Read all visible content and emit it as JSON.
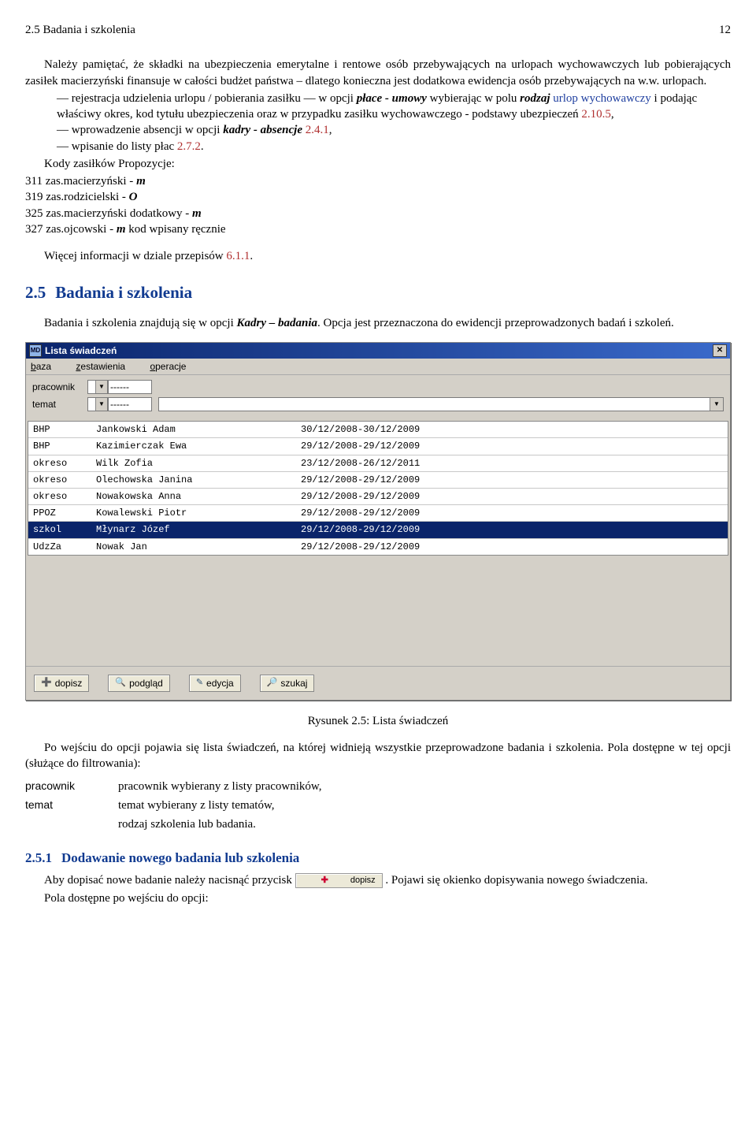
{
  "header": {
    "left": "2.5 Badania i szkolenia",
    "page": "12"
  },
  "intro1": "Należy pamiętać, że składki na ubezpieczenia emerytalne i rentowe osób przebywających na urlopach wychowawczych lub pobierających zasiłek macierzyński finansuje w całości budżet państwa – dlatego konieczna jest dodatkowa ewidencja osób przebywających na w.w. urlopach.",
  "bullets": [
    {
      "pre": "rejestracja udzielenia urlopu / pobierania zasiłku — w opcji ",
      "b1": "płace - umowy",
      "mid1": " wybierając w polu ",
      "b2": "rodzaj",
      "mid2": " ",
      "blue1": "urlop wychowawczy",
      "mid3": " i podając właściwy okres, kod tytułu ubezpieczenia oraz w przypadku zasiłku wychowawczego - podstawy ubezpieczeń ",
      "link1": "2.10.5",
      "tail": ","
    },
    {
      "pre": "wprowadzenie absencji w opcji ",
      "b1": "kadry - absencje",
      "mid1": " ",
      "link1": "2.4.1",
      "tail": ","
    },
    {
      "pre": "wpisanie do listy płac ",
      "link1": "2.7.2",
      "tail": "."
    }
  ],
  "kody_header": "Kody zasiłków Propozycje:",
  "kody": [
    {
      "t": "311 zas.macierzyński - ",
      "b": "m"
    },
    {
      "t": "319 zas.rodzicielski - ",
      "b": "O"
    },
    {
      "t": "325 zas.macierzyński dodatkowy - ",
      "b": "m"
    },
    {
      "t": "327 zas.ojcowski - ",
      "b": "m",
      "extra": " kod wpisany ręcznie"
    }
  ],
  "more_info_pre": "Więcej informacji w dziale przepisów ",
  "more_info_link": "6.1.1",
  "more_info_tail": ".",
  "sec25_num": "2.5",
  "sec25_title": "Badania i szkolenia",
  "sec25_intro_pre": "Badania i szkolenia znajdują się w opcji ",
  "sec25_intro_b": "Kadry – badania",
  "sec25_intro_tail": ". Opcja jest przeznaczona do ewidencji przeprowadzonych badań i szkoleń.",
  "window": {
    "title": "Lista świadczeń",
    "icon_text": "MD",
    "menu": [
      {
        "u": "b",
        "rest": "aza"
      },
      {
        "u": "z",
        "rest": "estawienia"
      },
      {
        "u": "o",
        "rest": "peracje"
      }
    ],
    "filter1_label": "pracownik",
    "filter1_value": "------",
    "filter2_label": "temat",
    "filter2_value": "------",
    "rows": [
      {
        "c1": "BHP",
        "c2": "Jankowski Adam",
        "c3": "30/12/2008-30/12/2009",
        "sel": false
      },
      {
        "c1": "BHP",
        "c2": "Kazimierczak Ewa",
        "c3": "29/12/2008-29/12/2009",
        "sel": false
      },
      {
        "c1": "okreso",
        "c2": "Wilk Zofia",
        "c3": "23/12/2008-26/12/2011",
        "sel": false
      },
      {
        "c1": "okreso",
        "c2": "Olechowska Janina",
        "c3": "29/12/2008-29/12/2009",
        "sel": false
      },
      {
        "c1": "okreso",
        "c2": "Nowakowska Anna",
        "c3": "29/12/2008-29/12/2009",
        "sel": false
      },
      {
        "c1": "PPOZ",
        "c2": "Kowalewski Piotr",
        "c3": "29/12/2008-29/12/2009",
        "sel": false
      },
      {
        "c1": "szkol",
        "c2": "Młynarz Józef",
        "c3": "29/12/2008-29/12/2009",
        "sel": true
      },
      {
        "c1": "UdzZa",
        "c2": "Nowak Jan",
        "c3": "29/12/2008-29/12/2009",
        "sel": false
      }
    ],
    "buttons": [
      {
        "icon": "➕",
        "color": "#c03",
        "label": "dopisz"
      },
      {
        "icon": "🔍",
        "color": "#357",
        "label": "podgląd"
      },
      {
        "icon": "✎",
        "color": "#357",
        "label": "edycja"
      },
      {
        "icon": "🔎",
        "color": "#775",
        "label": "szukaj"
      }
    ]
  },
  "fig_caption": "Rysunek 2.5: Lista świadczeń",
  "after_fig": "Po wejściu do opcji pojawia się lista świadczeń, na której widnieją wszystkie przeprowadzone badania i szkolenia. Pola dostępne w tej opcji (służące do filtrowania):",
  "def": [
    {
      "k": "pracownik",
      "v": "pracownik wybierany z listy pracowników,"
    },
    {
      "k": "temat",
      "v": "temat wybierany z listy tematów,"
    },
    {
      "k": "",
      "v": "rodzaj szkolenia lub badania."
    }
  ],
  "sec251_num": "2.5.1",
  "sec251_title": "Dodawanie nowego badania lub szkolenia",
  "sec251_p1_pre": "Aby dopisać nowe badanie należy nacisnąć przycisk ",
  "sec251_btn": "dopisz",
  "sec251_p1_tail": " . Pojawi się okienko dopisywania nowego świadczenia.",
  "sec251_p2": "Pola dostępne po wejściu do opcji:"
}
